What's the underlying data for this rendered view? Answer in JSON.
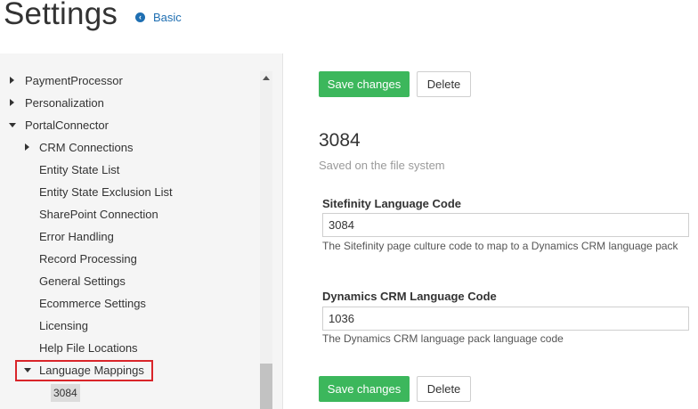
{
  "header": {
    "title": "Settings",
    "back_label": "Basic",
    "back_icon": "arrow-left-circle-icon"
  },
  "sidebar": {
    "items": [
      {
        "label": "PaymentProcessor"
      },
      {
        "label": "Personalization"
      },
      {
        "label": "PortalConnector"
      },
      {
        "label": "CRM Connections"
      },
      {
        "label": "Entity State List"
      },
      {
        "label": "Entity State Exclusion List"
      },
      {
        "label": "SharePoint Connection"
      },
      {
        "label": "Error Handling"
      },
      {
        "label": "Record Processing"
      },
      {
        "label": "General Settings"
      },
      {
        "label": "Ecommerce Settings"
      },
      {
        "label": "Licensing"
      },
      {
        "label": "Help File Locations"
      },
      {
        "label": "Language Mappings"
      }
    ],
    "selected_leaf": "3084"
  },
  "main": {
    "save_label": "Save changes",
    "delete_label": "Delete",
    "item_title": "3084",
    "item_subtitle": "Saved on the file system",
    "fields": [
      {
        "label": "Sitefinity Language Code",
        "value": "3084",
        "help": "The Sitefinity page culture code to map to a Dynamics CRM language pack"
      },
      {
        "label": "Dynamics CRM Language Code",
        "value": "1036",
        "help": "The Dynamics CRM language pack language code"
      }
    ]
  },
  "colors": {
    "primary_button": "#3cb75c",
    "link": "#1f6fb2",
    "highlight": "#d9252a"
  }
}
